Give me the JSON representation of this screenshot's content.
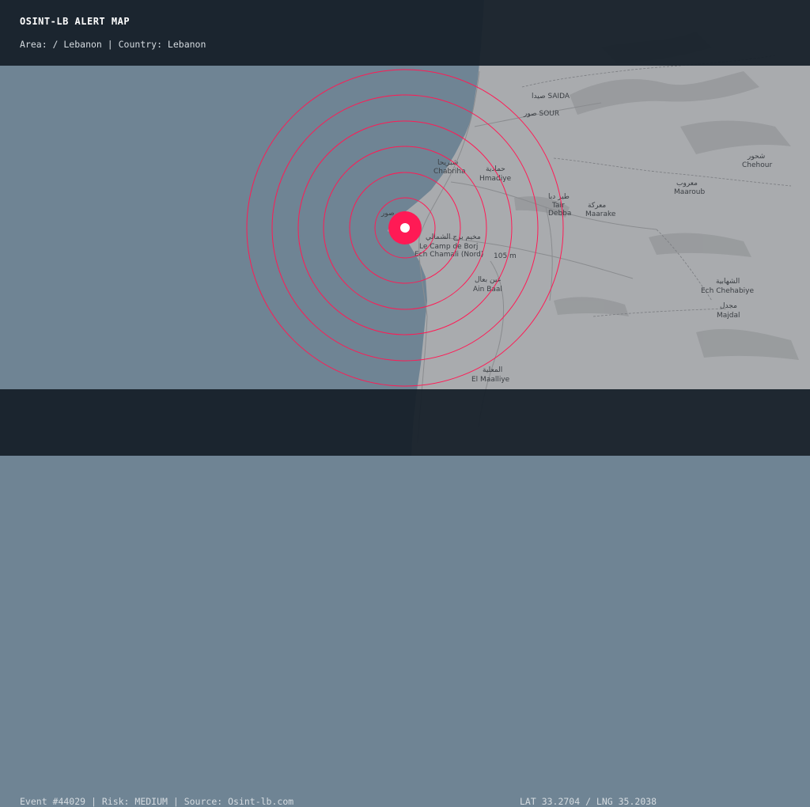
{
  "header": {
    "title": "OSINT-LB ALERT MAP",
    "area_line": "Area: / Lebanon | Country: Lebanon"
  },
  "footer": {
    "event_line": "Event #44029 | Risk: MEDIUM | Source: Osint-lb.com",
    "coords_line": "LAT 33.2704 / LNG 35.2038"
  },
  "map": {
    "sea_color": "#6f8494",
    "land_color": "#a8aaad",
    "alert_color": "#ff1a55",
    "ring_count": 6,
    "labels": {
      "saida_ar": "صيدا SAIDA",
      "sour_ar": "صور SOUR",
      "chabriha": "Chabriha",
      "chabriha_ar": "شبريحا",
      "hmadiye": "Hmadiye",
      "hmadiye_ar": "حمادية",
      "tair_debba": "Tair",
      "tair_debba2": "Debba",
      "tair_ar": "طير دبا",
      "maaraké": "Maarake",
      "maarake_ar": "معركة",
      "maaroub": "Maaroub",
      "maaroub_ar": "معروب",
      "chehour": "Chehour",
      "chehour_ar": "شحور",
      "borj": "Le Camp de Borj",
      "borj2": "Ech Chamali (Nord)",
      "borj_ar": "مخيم برج الشمالي",
      "elev": "105 m",
      "ain_baal": "Ain Baal",
      "ain_baal_ar": "عين بعال",
      "ech_chehabiye": "Ech Chehabiye",
      "chehabiye_ar": "الشهابية",
      "majdal": "Majdal",
      "majdal_ar": "مجدل",
      "el_maalliye": "El Maalliye",
      "maalliye_ar": "المعلية",
      "sour_marker_ar": "صور"
    }
  }
}
